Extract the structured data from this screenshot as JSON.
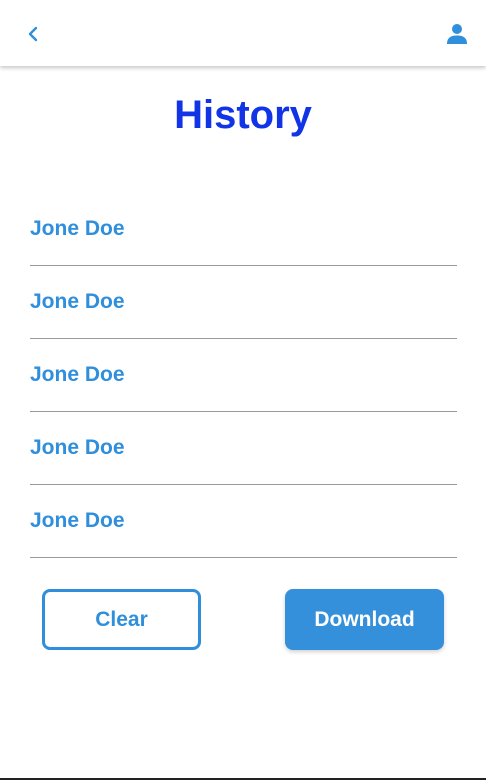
{
  "colors": {
    "accent": "#2f8fdc",
    "title": "#1034e6",
    "divider": "#9a9a9a",
    "button_fill": "#3590dc",
    "background": "#ffffff"
  },
  "header": {
    "back_icon": "chevron-left-icon",
    "profile_icon": "person-icon"
  },
  "page": {
    "title": "History"
  },
  "history": {
    "items": [
      {
        "label": "Jone Doe"
      },
      {
        "label": "Jone Doe"
      },
      {
        "label": "Jone Doe"
      },
      {
        "label": "Jone Doe"
      },
      {
        "label": "Jone Doe"
      }
    ]
  },
  "actions": {
    "clear_label": "Clear",
    "download_label": "Download"
  }
}
